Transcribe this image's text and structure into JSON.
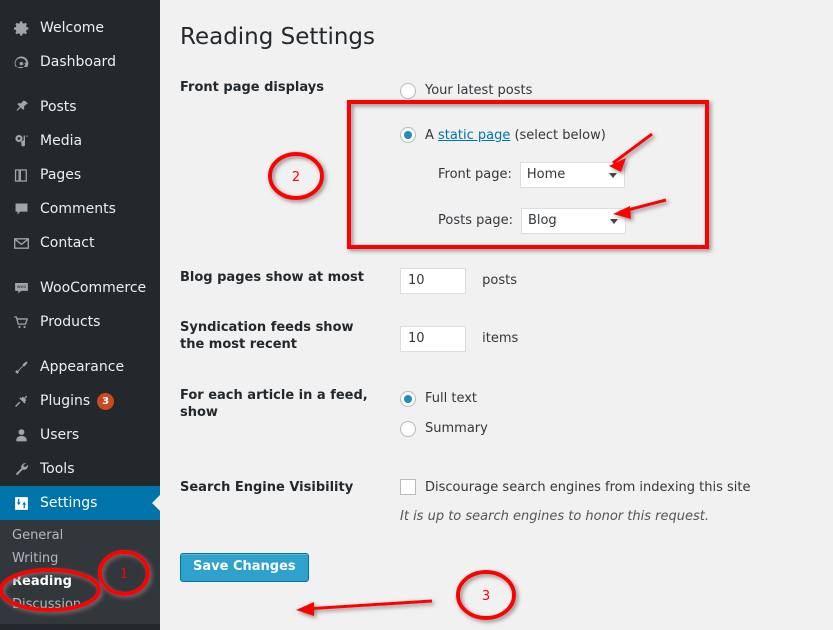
{
  "sidebar": {
    "items": [
      {
        "label": "Welcome",
        "icon": "gear-icon",
        "active": false,
        "badge": null
      },
      {
        "label": "Dashboard",
        "icon": "dashboard-icon",
        "active": false,
        "badge": null
      },
      {
        "label": "Posts",
        "icon": "pushpin-icon",
        "active": false,
        "badge": null
      },
      {
        "label": "Media",
        "icon": "media-icon",
        "active": false,
        "badge": null
      },
      {
        "label": "Pages",
        "icon": "pages-icon",
        "active": false,
        "badge": null
      },
      {
        "label": "Comments",
        "icon": "comment-icon",
        "active": false,
        "badge": null
      },
      {
        "label": "Contact",
        "icon": "envelope-icon",
        "active": false,
        "badge": null
      },
      {
        "label": "WooCommerce",
        "icon": "woocommerce-icon",
        "active": false,
        "badge": null
      },
      {
        "label": "Products",
        "icon": "cart-icon",
        "active": false,
        "badge": null
      },
      {
        "label": "Appearance",
        "icon": "brush-icon",
        "active": false,
        "badge": null
      },
      {
        "label": "Plugins",
        "icon": "plug-icon",
        "active": false,
        "badge": "3"
      },
      {
        "label": "Users",
        "icon": "user-icon",
        "active": false,
        "badge": null
      },
      {
        "label": "Tools",
        "icon": "wrench-icon",
        "active": false,
        "badge": null
      },
      {
        "label": "Settings",
        "icon": "sliders-icon",
        "active": true,
        "badge": null
      }
    ],
    "submenu": [
      {
        "label": "General",
        "current": false
      },
      {
        "label": "Writing",
        "current": false
      },
      {
        "label": "Reading",
        "current": true
      },
      {
        "label": "Discussion",
        "current": false
      }
    ],
    "colors": {
      "background": "#23282d",
      "submenu_background": "#32373c",
      "active_background": "#0073aa",
      "badge_background": "#ca4a1f"
    }
  },
  "page": {
    "title": "Reading Settings"
  },
  "front_page_displays": {
    "label": "Front page displays",
    "options": [
      {
        "label": "Your latest posts",
        "selected": false
      },
      {
        "label_prefix": "A ",
        "link_text": "static page",
        "label_suffix": " (select below)",
        "selected": true
      }
    ],
    "front_page": {
      "caption": "Front page:",
      "value": "Home"
    },
    "posts_page": {
      "caption": "Posts page:",
      "value": "Blog"
    }
  },
  "blog_pages": {
    "label": "Blog pages show at most",
    "value": "10",
    "unit": "posts"
  },
  "syndication_feeds": {
    "label": "Syndication feeds show the most recent",
    "value": "10",
    "unit": "items"
  },
  "feed_article": {
    "label": "For each article in a feed, show",
    "options": [
      {
        "label": "Full text",
        "selected": true
      },
      {
        "label": "Summary",
        "selected": false
      }
    ]
  },
  "search_engine_visibility": {
    "label": "Search Engine Visibility",
    "checkbox_label": "Discourage search engines from indexing this site",
    "checked": false,
    "description": "It is up to search engines to honor this request."
  },
  "actions": {
    "save_label": "Save Changes",
    "save_color": "#2ea2cc"
  },
  "annotations": {
    "color": "#ff0000",
    "markers": [
      {
        "id": "1",
        "target": "sidebar-reading-item"
      },
      {
        "id": "2",
        "target": "static-page-group"
      },
      {
        "id": "3",
        "target": "save-changes-button"
      }
    ]
  }
}
